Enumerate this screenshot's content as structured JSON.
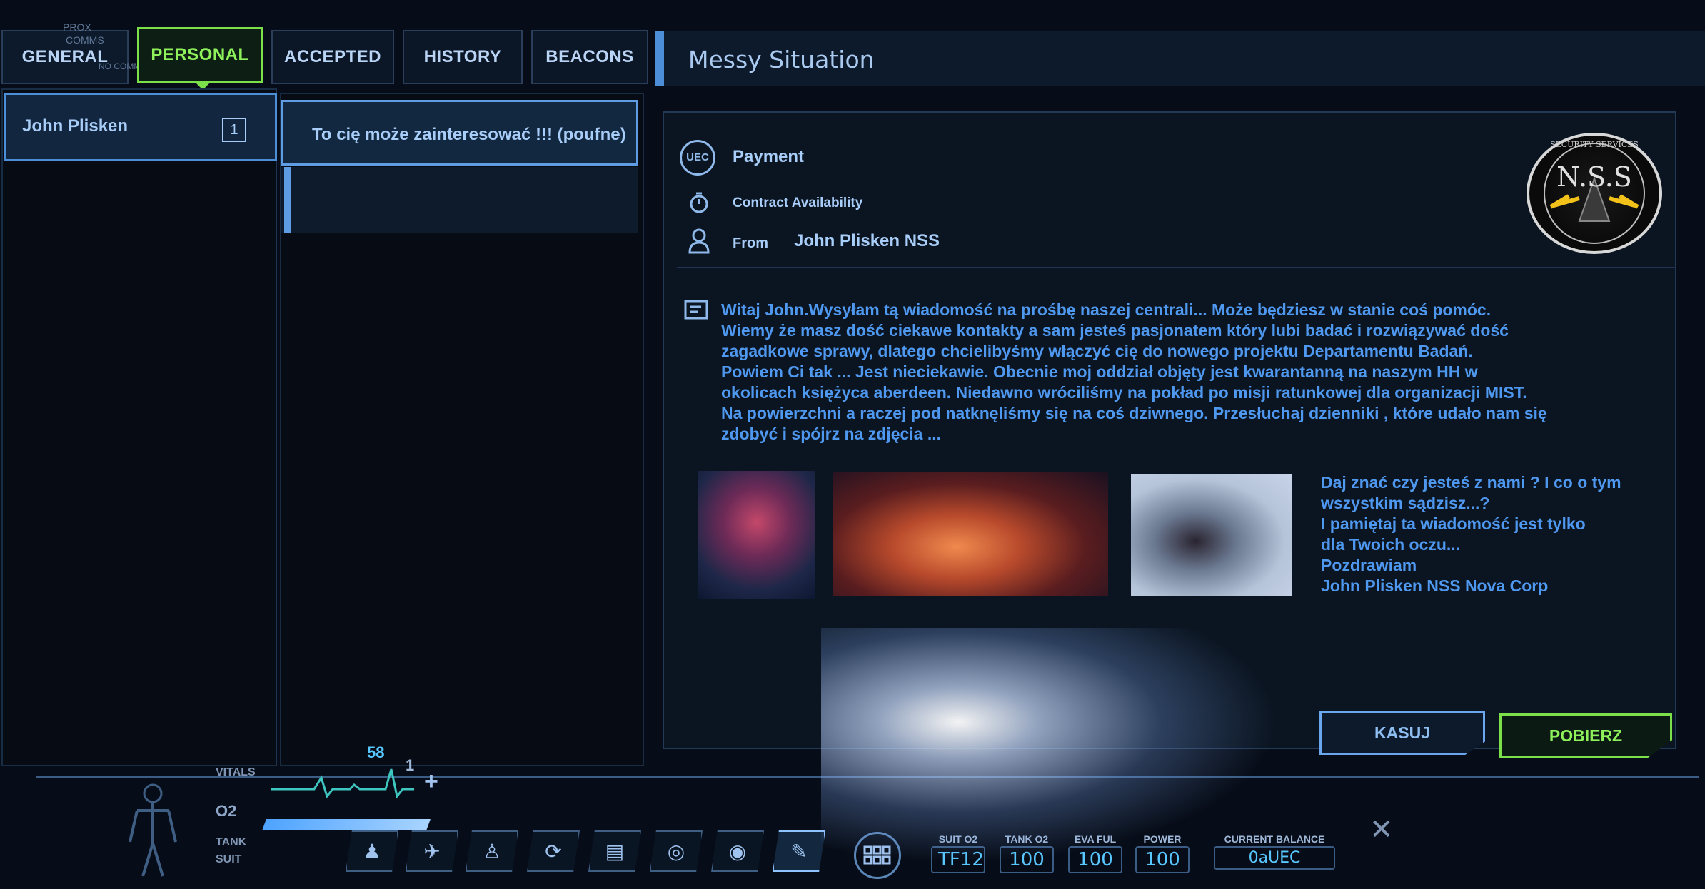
{
  "tabs": {
    "general": "GENERAL",
    "general_overlay_top": "PROX",
    "general_overlay_mid": "COMMS",
    "general_overlay_bottom": "NO COMMS CONNECTION",
    "personal": "PERSONAL",
    "accepted": "ACCEPTED",
    "history": "HISTORY",
    "beacons": "BEACONS"
  },
  "title": "Messy Situation",
  "contacts": [
    {
      "name": "John Plisken",
      "count": "1"
    }
  ],
  "messages": [
    {
      "subject": "To cię może zainteresować  !!! (poufne)"
    }
  ],
  "detail": {
    "payment_label": "Payment",
    "uec_icon": "UEC",
    "availability_label": "Contract Availability",
    "from_label": "From",
    "from_value": "John Plisken NSS",
    "logo_text": "N.S.S",
    "logo_ring_text": "SECURITY SERVICES",
    "body": "Witaj John.Wysyłam tą wiadomość na prośbę naszej centrali... Może będziesz w stanie coś pomóc.\nWiemy że masz dość ciekawe kontakty a sam jesteś pasjonatem który lubi badać i rozwiązywać dość\nzagadkowe sprawy, dlatego chcielibyśmy włączyć cię do nowego projektu Departamentu Badań.\nPowiem Ci tak ... Jest nieciekawie. Obecnie moj oddział objęty jest kwarantanną na naszym HH w\nokolicach księżyca aberdeen. Niedawno wróciliśmy na pokład po misji ratunkowej dla organizacji MIST.\nNa powierzchni a raczej pod natknęliśmy się na coś dziwnego. Przesłuchaj dzienniki , które udało nam się\nzdobyć i spójrz na zdjęcia ...",
    "side_text": "Daj znać czy jesteś z nami ? I co o tym\nwszystkim sądzisz...?\nI pamiętaj ta wiadomość jest tylko\ndla Twoich oczu...\nPozdrawiam\nJohn Plisken NSS Nova Corp",
    "delete_button": "KASUJ",
    "download_button": "POBIERZ"
  },
  "hud": {
    "vitals_label": "VITALS",
    "heart_rate": "58",
    "o2_label": "O2",
    "tank_label": "TANK",
    "suit_label": "SUIT",
    "gauge_marker": "1",
    "stats": [
      {
        "label": "SUIT O2",
        "value": "TF12"
      },
      {
        "label": "TANK O2",
        "value": "100"
      },
      {
        "label": "EVA FUL",
        "value": "100"
      },
      {
        "label": "POWER",
        "value": "100"
      }
    ],
    "balance_label": "CURRENT BALANCE",
    "balance_value": "0aUEC"
  },
  "colors": {
    "accent_blue": "#4c8fd8",
    "accent_green": "#7be04a",
    "body_text": "#4f98f0"
  }
}
